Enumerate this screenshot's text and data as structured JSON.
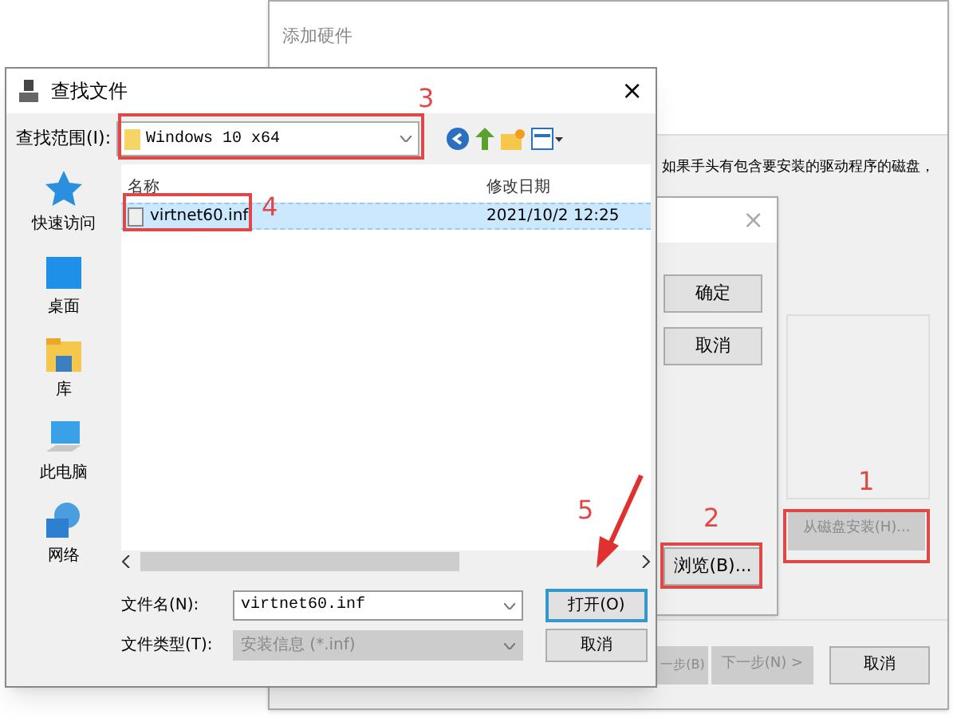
{
  "back_window": {
    "title": "添加硬件",
    "instruction": "如果手头有包含要安装的驱动程序的磁盘，",
    "disk_button": {
      "label": "从磁盘安装(H)...",
      "disabled": true
    },
    "footer_buttons": [
      {
        "label": "一步(B)",
        "disabled": true
      },
      {
        "label": "下一步(N) >",
        "disabled": true
      },
      {
        "label": "取消",
        "disabled": false
      }
    ]
  },
  "disk_window": {
    "close": "×",
    "buttons": [
      "确定",
      "取消"
    ],
    "browse": "浏览(B)..."
  },
  "dialog": {
    "title": "查找文件",
    "close": "×",
    "look_in_label": "查找范围(I):",
    "look_in_value": "Windows 10 x64",
    "places": [
      {
        "label": "快速访问",
        "kind": "star"
      },
      {
        "label": "桌面",
        "kind": "desktop"
      },
      {
        "label": "库",
        "kind": "library"
      },
      {
        "label": "此电脑",
        "kind": "computer"
      },
      {
        "label": "网络",
        "kind": "network"
      }
    ],
    "columns": [
      "名称",
      "修改日期"
    ],
    "files": [
      {
        "name": "virtnet60.inf",
        "modified": "2021/10/2 12:25",
        "selected": true
      }
    ],
    "file_name_label": "文件名(N):",
    "file_name_value": "virtnet60.inf",
    "file_type_label": "文件类型(T):",
    "file_type_value": "安装信息 (*.inf)",
    "file_type_disabled": true,
    "open_button": "打开(O)",
    "cancel_button": "取消"
  },
  "annotations": [
    "1",
    "2",
    "3",
    "4",
    "5"
  ]
}
